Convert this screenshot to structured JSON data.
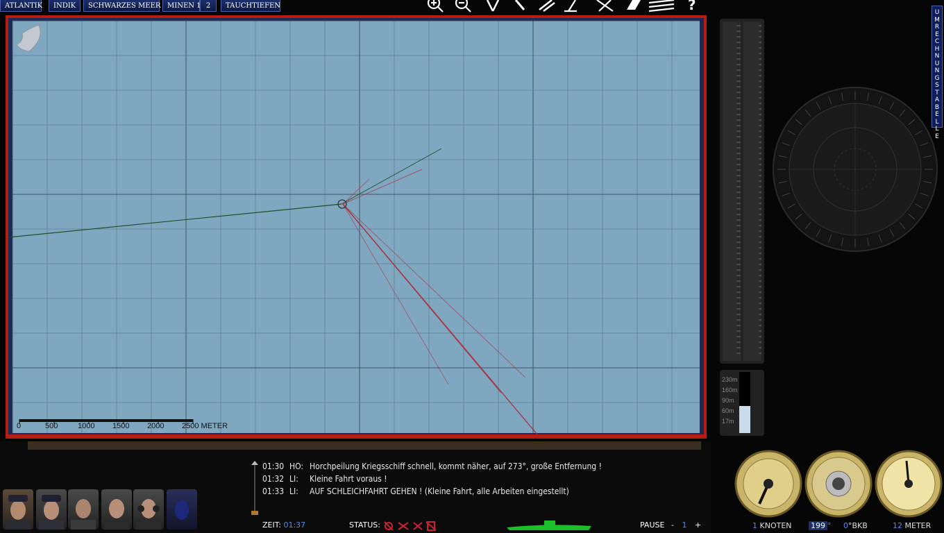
{
  "map_tabs": [
    "ATLANTIK",
    "INDIK",
    "SCHWARZES MEER",
    "MINEN 1",
    "2",
    "TAUCHTIEFEN"
  ],
  "toolbar_icons": [
    "zoom-in-icon",
    "zoom-out-icon",
    "compass-divider-icon",
    "pencil-icon",
    "ruler-icon",
    "protractor-icon",
    "plot-icon",
    "eraser-icon",
    "delete-all-icon",
    "help-icon"
  ],
  "help_glyph": "?",
  "map": {
    "scale_labels": [
      "0",
      "500",
      "1000",
      "1500",
      "2000",
      "2500 METER"
    ]
  },
  "side_tab": "UMRECHNUNGSTABELLE",
  "depth_bar_labels": [
    "230m",
    "160m",
    "90m",
    "60m",
    "17m"
  ],
  "messages": [
    {
      "time": "01:30",
      "speaker": "HO:",
      "text": "Horchpeilung Kriegsschiff schnell, kommt näher, auf 273°, große Entfernung !"
    },
    {
      "time": "01:32",
      "speaker": "LI:",
      "text": "Kleine Fahrt voraus !"
    },
    {
      "time": "01:33",
      "speaker": "LI:",
      "text": "AUF SCHLEICHFAHRT GEHEN ! (Kleine Fahrt, alle Arbeiten eingestellt)"
    }
  ],
  "status": {
    "zeit_label": "ZEIT:",
    "zeit_value": "01:37",
    "status_label": "STATUS:",
    "pause_label": "PAUSE",
    "pause_minus": "-",
    "pause_value": "1",
    "pause_plus": "+"
  },
  "gauges": {
    "speed_value": "1",
    "speed_unit": "KNOTEN",
    "heading_value": "199",
    "heading_unit": "°",
    "bkb_value": "0",
    "bkb_unit": "°BKB",
    "depth_value": "12",
    "depth_unit": "METER"
  },
  "colors": {
    "map_water": "#7fa7bf",
    "map_frame": "#b71c14",
    "tab_blue": "#1c2e6a",
    "accent_blue": "#5c8ae6",
    "sound_bearing_red": "#a8303a",
    "course_green": "#1f4f2a"
  }
}
